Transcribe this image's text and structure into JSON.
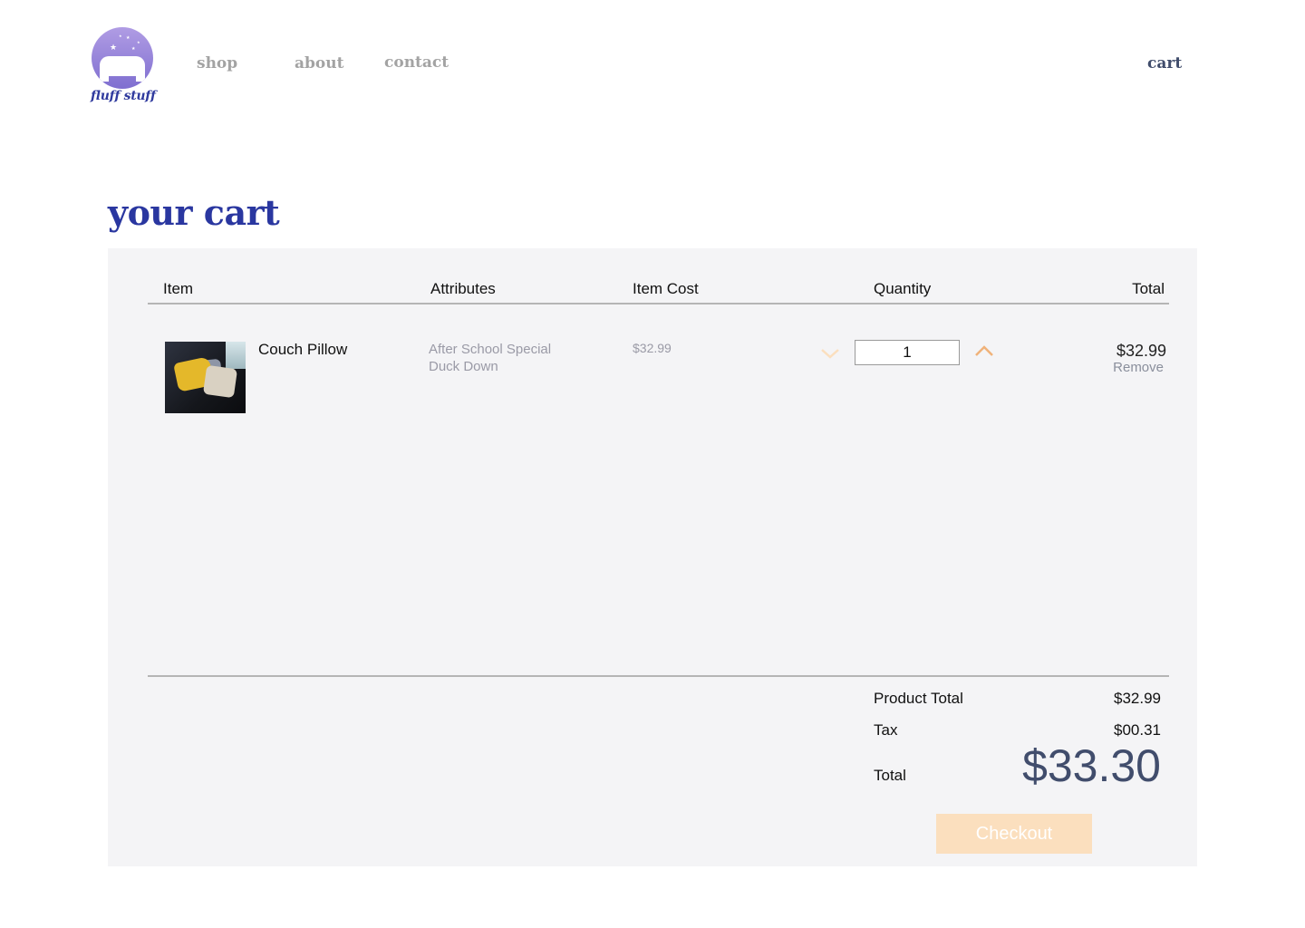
{
  "brand": {
    "name": "fluff stuff",
    "logo_icon": "pillow-stars-icon",
    "logo_color": "#9a89dc"
  },
  "nav": {
    "shop": "shop",
    "about": "about",
    "contact": "contact",
    "cart": "cart"
  },
  "page": {
    "title": "your cart"
  },
  "table": {
    "headers": {
      "item": "Item",
      "attributes": "Attributes",
      "item_cost": "Item Cost",
      "quantity": "Quantity",
      "total": "Total"
    }
  },
  "cart": {
    "items": [
      {
        "name": "Couch Pillow",
        "attributes": [
          "After School Special",
          "Duck Down"
        ],
        "cost": "$32.99",
        "quantity": "1",
        "total": "$32.99",
        "remove_label": "Remove",
        "image_icon": "couch-pillow-photo"
      }
    ]
  },
  "summary": {
    "product_total_label": "Product Total",
    "product_total": "$32.99",
    "tax_label": "Tax",
    "tax": "$00.31",
    "total_label": "Total",
    "total": "$33.30",
    "checkout_label": "Checkout"
  },
  "colors": {
    "title": "#2a37a0",
    "accent_orange": "#f0b27a",
    "checkout_bg": "#fbdfbe",
    "total_text": "#414d6c",
    "panel_bg": "#f4f4f6"
  }
}
